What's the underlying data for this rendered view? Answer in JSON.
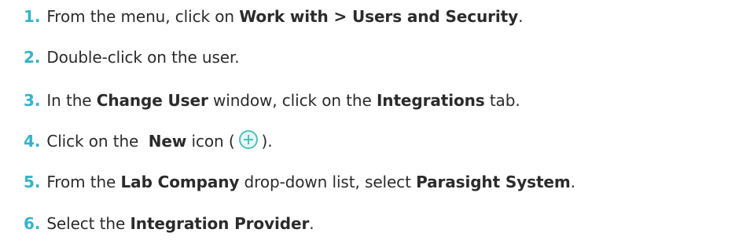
{
  "steps": [
    {
      "number": "1.",
      "t1": "From the menu, click on ",
      "b1": "Work with > Users and Security",
      "t2": "."
    },
    {
      "number": "2.",
      "t1": "Double-click on the user."
    },
    {
      "number": "3.",
      "t1": "In the ",
      "b1": "Change User",
      "t2": " window, click on the ",
      "b2": "Integrations",
      "t3": " tab."
    },
    {
      "number": "4.",
      "t1": "Click on the  ",
      "b1": "New",
      "t2": " icon (",
      "icon": "plus-circle-icon",
      "t3": ")."
    },
    {
      "number": "5.",
      "t1": "From the ",
      "b1": "Lab Company",
      "t2": " drop-down list, select ",
      "b2": "Parasight System",
      "t3": "."
    },
    {
      "number": "6.",
      "t1": "Select the ",
      "b1": "Integration Provider",
      "t2": "."
    }
  ],
  "colors": {
    "number": "#35b3c9",
    "icon_stroke": "#4cc3b9",
    "icon_fill": "#e6f8f6"
  }
}
